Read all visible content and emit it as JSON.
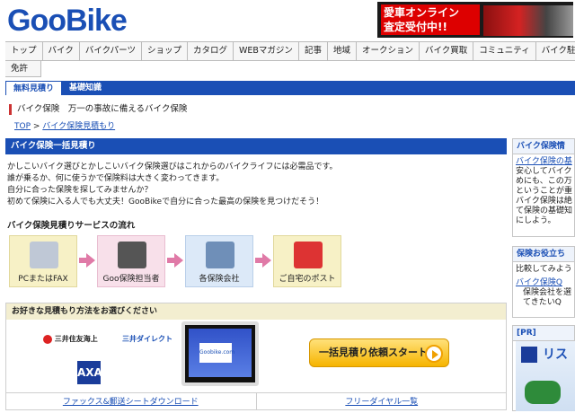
{
  "header": {
    "logo_goo": "Goo",
    "logo_bike": "Bike",
    "banner_text_line1": "愛車オンライン",
    "banner_text_line2": "査定受付中!!"
  },
  "nav": {
    "items": [
      "トップ",
      "バイク",
      "バイクパーツ",
      "ショップ",
      "カタログ",
      "WEBマガジン",
      "記事",
      "地域",
      "オークション",
      "バイク買取",
      "コミュニティ",
      "バイク駐車場"
    ],
    "row2": "免許"
  },
  "subtabs": {
    "active": "無料見積り",
    "other": "基礎知識"
  },
  "page": {
    "head": "バイク保険　万一の事故に備えるバイク保険",
    "breadcrumb_top": "TOP",
    "breadcrumb_sep": " > ",
    "breadcrumb_current": "バイク保険見積もり"
  },
  "main": {
    "section_title": "バイク保険一括見積り",
    "intro": [
      "かしこいバイク選びとかしこいバイク保険選びはこれからのバイクライフには必需品です。",
      "誰が乗るか、何に使うかで保険料は大きく変わってきます。",
      "自分に合った保険を探してみませんか？",
      "初めて保険に入る人でも大丈夫！GooBikeで自分に合った最高の保険を見つけだそう！"
    ],
    "flow_title": "バイク保険見積りサービスの流れ",
    "flow": [
      "PCまたはFAX",
      "Goo保険担当者",
      "各保険会社",
      "ご自宅のポスト"
    ],
    "method_title": "お好きな見積もり方法をお選びください",
    "insurers": [
      "三井住友海上",
      "三井ダイレクト"
    ],
    "monitor_text": "Goobike.com",
    "start_button": "一括見積り依頼スタート",
    "bottom_links": [
      "ファックス&郵送シートダウンロード",
      "フリーダイヤル一覧"
    ]
  },
  "right": {
    "box1_title": "バイク保険情",
    "box1_link": "バイク保険の基",
    "box1_lines": [
      "安心してバイク",
      "めにも、この万",
      "ということが重",
      "バイク保険は絶",
      "て保険の基礎知",
      "にしよう。"
    ],
    "box2_title": "保険お役立ち",
    "box2_line": "比較してみよう",
    "box2_link": "バイク保険Q",
    "box2_lines": [
      "保険会社を選",
      "てきたいQ"
    ],
    "pr_label": "[PR]",
    "pr_text": "リス"
  }
}
